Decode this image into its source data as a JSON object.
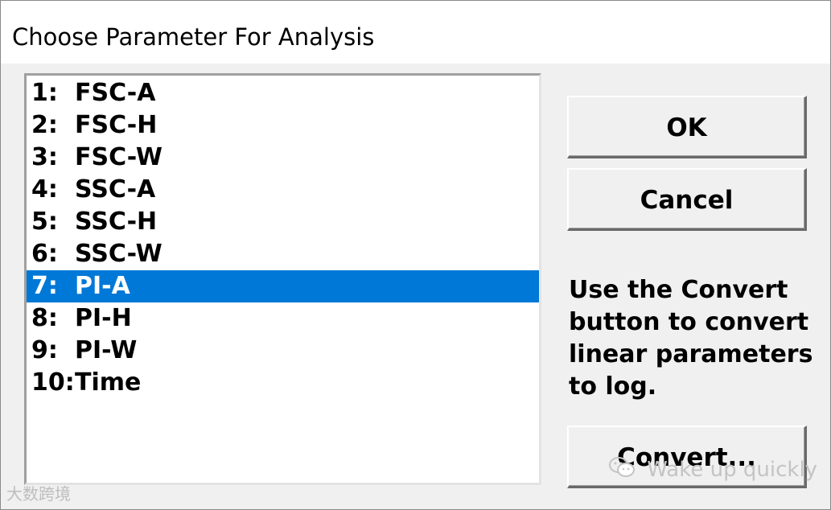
{
  "dialog": {
    "title": "Choose Parameter For Analysis"
  },
  "parameters": [
    {
      "num": "1:",
      "name": "FSC-A",
      "selected": false
    },
    {
      "num": "2:",
      "name": "FSC-H",
      "selected": false
    },
    {
      "num": "3:",
      "name": "FSC-W",
      "selected": false
    },
    {
      "num": "4:",
      "name": "SSC-A",
      "selected": false
    },
    {
      "num": "5:",
      "name": "SSC-H",
      "selected": false
    },
    {
      "num": "6:",
      "name": "SSC-W",
      "selected": false
    },
    {
      "num": "7:",
      "name": "PI-A",
      "selected": true
    },
    {
      "num": "8:",
      "name": "PI-H",
      "selected": false
    },
    {
      "num": "9:",
      "name": "PI-W",
      "selected": false
    },
    {
      "num": "10:",
      "name": "Time",
      "selected": false
    }
  ],
  "buttons": {
    "ok": "OK",
    "cancel": "Cancel",
    "convert": "Convert..."
  },
  "info_text": [
    "Use the Convert",
    "button to convert",
    "linear parameters",
    "to log."
  ],
  "watermarks": {
    "left": "大数跨境",
    "right": "Wake up quickly",
    "right_icon": "wechat-icon"
  },
  "colors": {
    "selection": "#0078d7",
    "dialog_bg": "#f0f0f0"
  }
}
